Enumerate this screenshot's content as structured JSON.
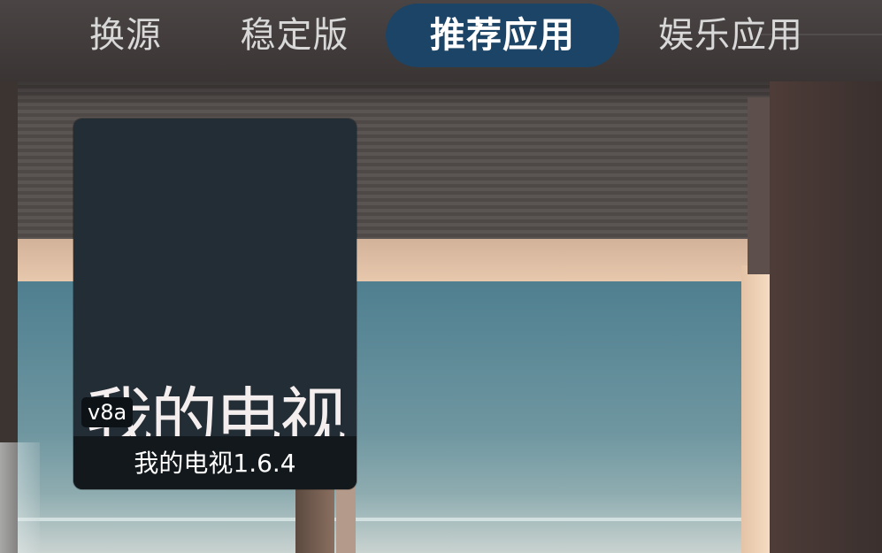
{
  "tabs": [
    {
      "label": "换源",
      "active": false
    },
    {
      "label": "稳定版",
      "active": false
    },
    {
      "label": "推荐应用",
      "active": true
    },
    {
      "label": "娱乐应用",
      "active": false
    }
  ],
  "colors": {
    "active_tab_bg": "#1c4466",
    "card_bg": "#232d36",
    "card_footer_bg": "#12181c"
  },
  "apps": [
    {
      "icon_text": "我的电视",
      "badge": "v8a",
      "name": "我的电视1.6.4"
    }
  ]
}
